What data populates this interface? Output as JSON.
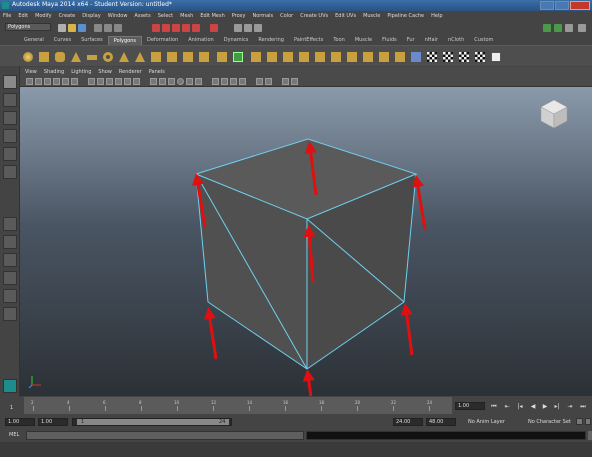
{
  "window": {
    "title": "Autodesk Maya 2014 x64 - Student Version: untitled*"
  },
  "menu": [
    "File",
    "Edit",
    "Modify",
    "Create",
    "Display",
    "Window",
    "Assets",
    "Select",
    "Mesh",
    "Edit Mesh",
    "Proxy",
    "Normals",
    "Color",
    "Create UVs",
    "Edit UVs",
    "Muscle",
    "Pipeline Cache",
    "Help"
  ],
  "statusline": {
    "mode": "Polygons"
  },
  "shelf_tabs": [
    "General",
    "Curves",
    "Surfaces",
    "Polygons",
    "Deformation",
    "Animation",
    "Dynamics",
    "Rendering",
    "PaintEffects",
    "Toon",
    "Muscle",
    "Fluids",
    "Fur",
    "nHair",
    "nCloth",
    "Custom"
  ],
  "shelf_active_tab": "Polygons",
  "panel_menu": [
    "View",
    "Shading",
    "Lighting",
    "Show",
    "Renderer",
    "Panels"
  ],
  "colors": {
    "wire": "#6fd0f0",
    "arrow": "#e01010",
    "face": "#555555"
  },
  "timeslider": {
    "ticks": [
      "2",
      "4",
      "6",
      "8",
      "10",
      "12",
      "14",
      "16",
      "18",
      "20",
      "22",
      "24"
    ],
    "start_frame": "1",
    "current": "1.00"
  },
  "range": {
    "start": "1.00",
    "playback_start": "1.00",
    "slider_start": "1",
    "slider_end": "24",
    "playback_end": "24.00",
    "end": "48.00",
    "anim_layer": "No Anim Layer",
    "char_set": "No Character Set"
  },
  "cmdline": {
    "label": "MEL"
  }
}
